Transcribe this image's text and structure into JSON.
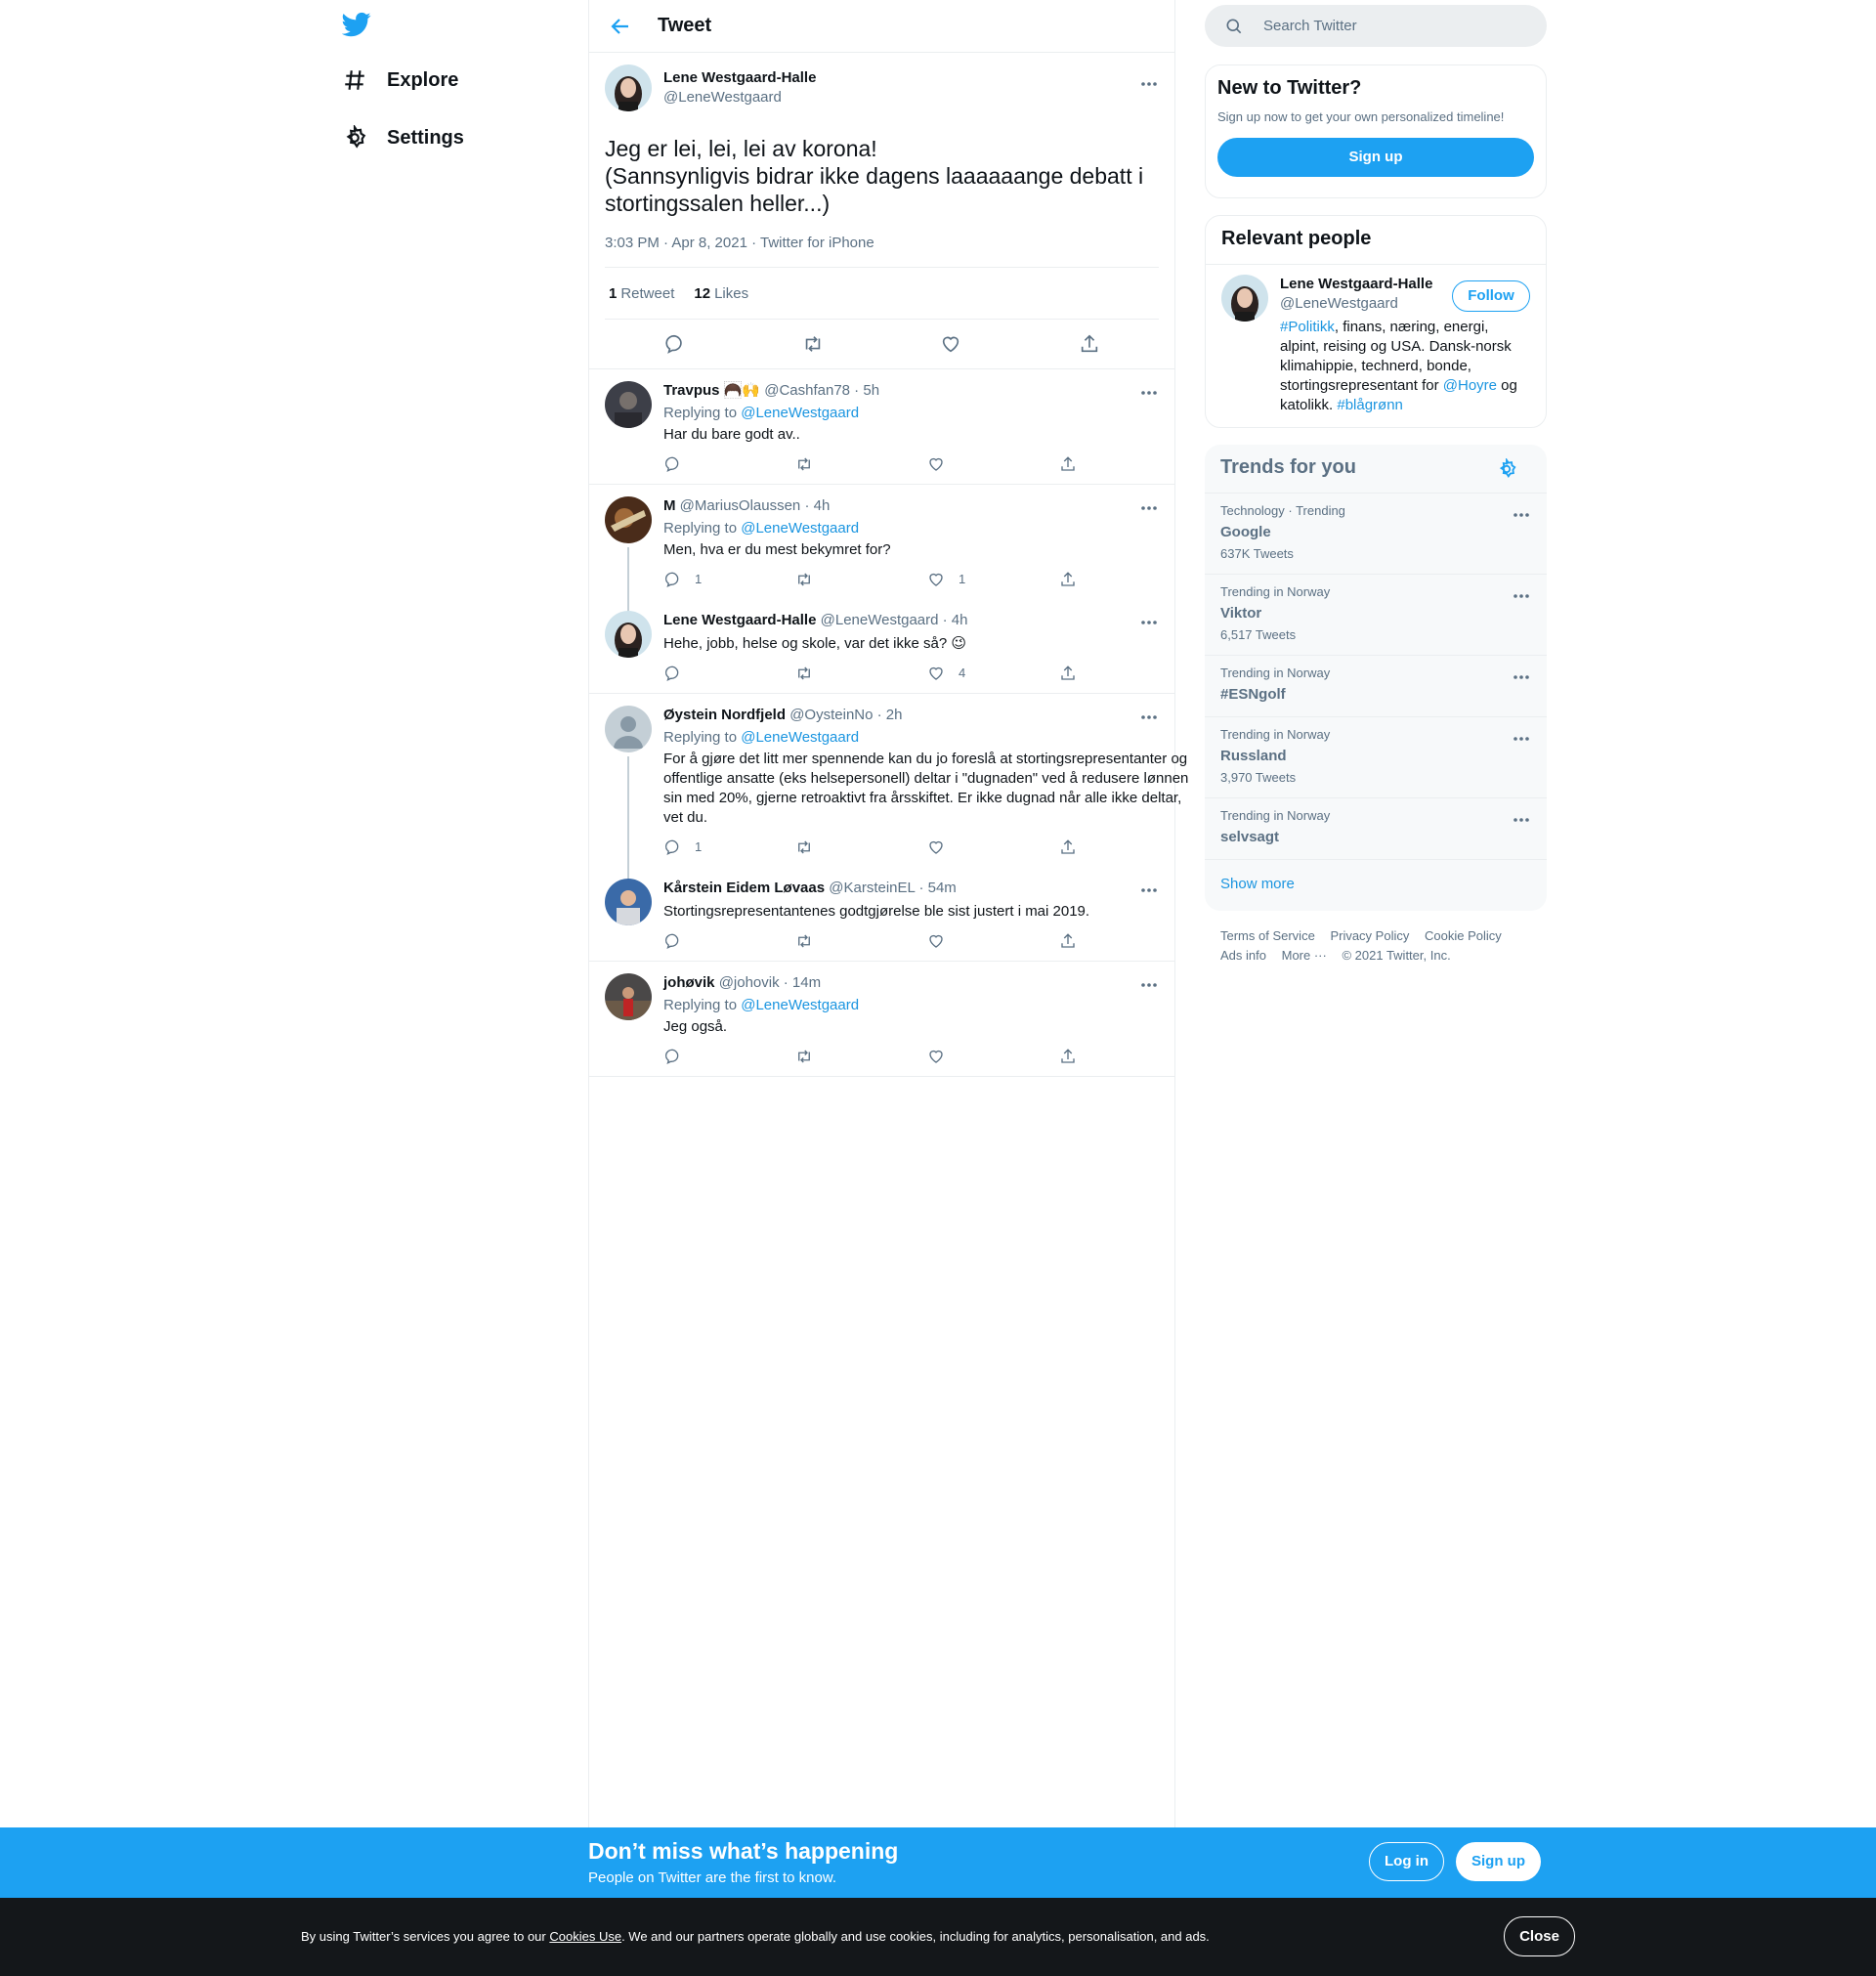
{
  "colors": {
    "accent": "#1da1f2",
    "link": "#1b95e0",
    "secondary_text": "#5b7083",
    "dark_bar": "#14171a"
  },
  "nav": {
    "explore": "Explore",
    "settings": "Settings"
  },
  "header": {
    "title": "Tweet"
  },
  "focal": {
    "name": "Lene Westgaard-Halle",
    "handle": "@LeneWestgaard",
    "text": "Jeg er lei, lei, lei av korona!\n(Sannsynligvis bidrar ikke dagens laaaaaange debatt i stortingssalen heller...)",
    "meta": "3:03 PM · Apr 8, 2021 · Twitter for iPhone",
    "retweets_count": "1",
    "retweets_label": "Retweet",
    "likes_count": "12",
    "likes_label": "Likes"
  },
  "replies": [
    {
      "name": "Travpus",
      "emoji": "🦱🙌",
      "handle": "@Cashfan78 · 5h",
      "replying_prefix": "Replying to",
      "replying_to": "@LeneWestgaard",
      "text": "Har du bare godt av..",
      "reply_count": "",
      "like_count": ""
    },
    {
      "name": "M",
      "emoji": "",
      "handle": "@MariusOlaussen · 4h",
      "replying_prefix": "Replying to",
      "replying_to": "@LeneWestgaard",
      "text": "Men, hva er du mest bekymret for?",
      "reply_count": "1",
      "like_count": "1"
    },
    {
      "name": "Lene Westgaard-Halle",
      "emoji": "",
      "handle": "@LeneWestgaard · 4h",
      "text": "Hehe, jobb, helse og skole, var det ikke så? 😉",
      "reply_count": "",
      "like_count": "4"
    },
    {
      "name": "Øystein Nordfjeld",
      "emoji": "",
      "handle": "@OysteinNo · 2h",
      "replying_prefix": "Replying to",
      "replying_to": "@LeneWestgaard",
      "text": "For å gjøre det litt mer spennende kan du jo foreslå at stortingsrepresentanter og offentlige ansatte (eks helsepersonell) deltar i \"dugnaden\" ved å redusere lønnen sin med 20%, gjerne retroaktivt fra årsskiftet. Er ikke dugnad når alle ikke deltar, vet du.",
      "reply_count": "1",
      "like_count": ""
    },
    {
      "name": "Kårstein Eidem Løvaas",
      "emoji": "",
      "handle": "@KarsteinEL · 54m",
      "text": "Stortingsrepresentantenes godtgjørelse ble sist justert i mai 2019.",
      "reply_count": "",
      "like_count": ""
    },
    {
      "name": "johøvik",
      "emoji": "",
      "handle": "@johovik · 14m",
      "replying_prefix": "Replying to",
      "replying_to": "@LeneWestgaard",
      "text": "Jeg også.",
      "reply_count": "",
      "like_count": ""
    }
  ],
  "search": {
    "placeholder": "Search Twitter"
  },
  "new_to_twitter": {
    "title": "New to Twitter?",
    "subtitle": "Sign up now to get your own personalized timeline!",
    "button": "Sign up"
  },
  "relevant": {
    "title": "Relevant people",
    "name": "Lene Westgaard-Halle",
    "handle": "@LeneWestgaard",
    "follow": "Follow",
    "bio_tag1": "#Politikk",
    "bio_part1": ", finans, næring, energi, alpint, reising og USA. Dansk-norsk klimahippie, technerd, bonde, stortingsrepresentant for ",
    "bio_mention": "@Hoyre",
    "bio_part2": " og katolikk. ",
    "bio_tag2": "#blågrønn"
  },
  "trends": {
    "title": "Trends for you",
    "items": [
      {
        "context": "Technology · Trending",
        "name": "Google",
        "count": "637K Tweets"
      },
      {
        "context": "Trending in Norway",
        "name": "Viktor",
        "count": "6,517 Tweets"
      },
      {
        "context": "Trending in Norway",
        "name": "#ESNgolf",
        "count": ""
      },
      {
        "context": "Trending in Norway",
        "name": "Russland",
        "count": "3,970 Tweets"
      },
      {
        "context": "Trending in Norway",
        "name": "selvsagt",
        "count": ""
      }
    ],
    "show_more": "Show more"
  },
  "footer": {
    "terms": "Terms of Service",
    "privacy": "Privacy Policy",
    "cookie": "Cookie Policy",
    "ads": "Ads info",
    "more": "More ···",
    "copyright": "© 2021 Twitter, Inc."
  },
  "bottombar": {
    "headline": "Don’t miss what’s happening",
    "sub": "People on Twitter are the first to know.",
    "login": "Log in",
    "signup": "Sign up"
  },
  "cookie": {
    "prefix": "By using Twitter’s services you agree to our ",
    "link": "Cookies Use",
    "suffix": ". We and our partners operate globally and use cookies, including for analytics, personalisation, and ads.",
    "close": "Close"
  }
}
